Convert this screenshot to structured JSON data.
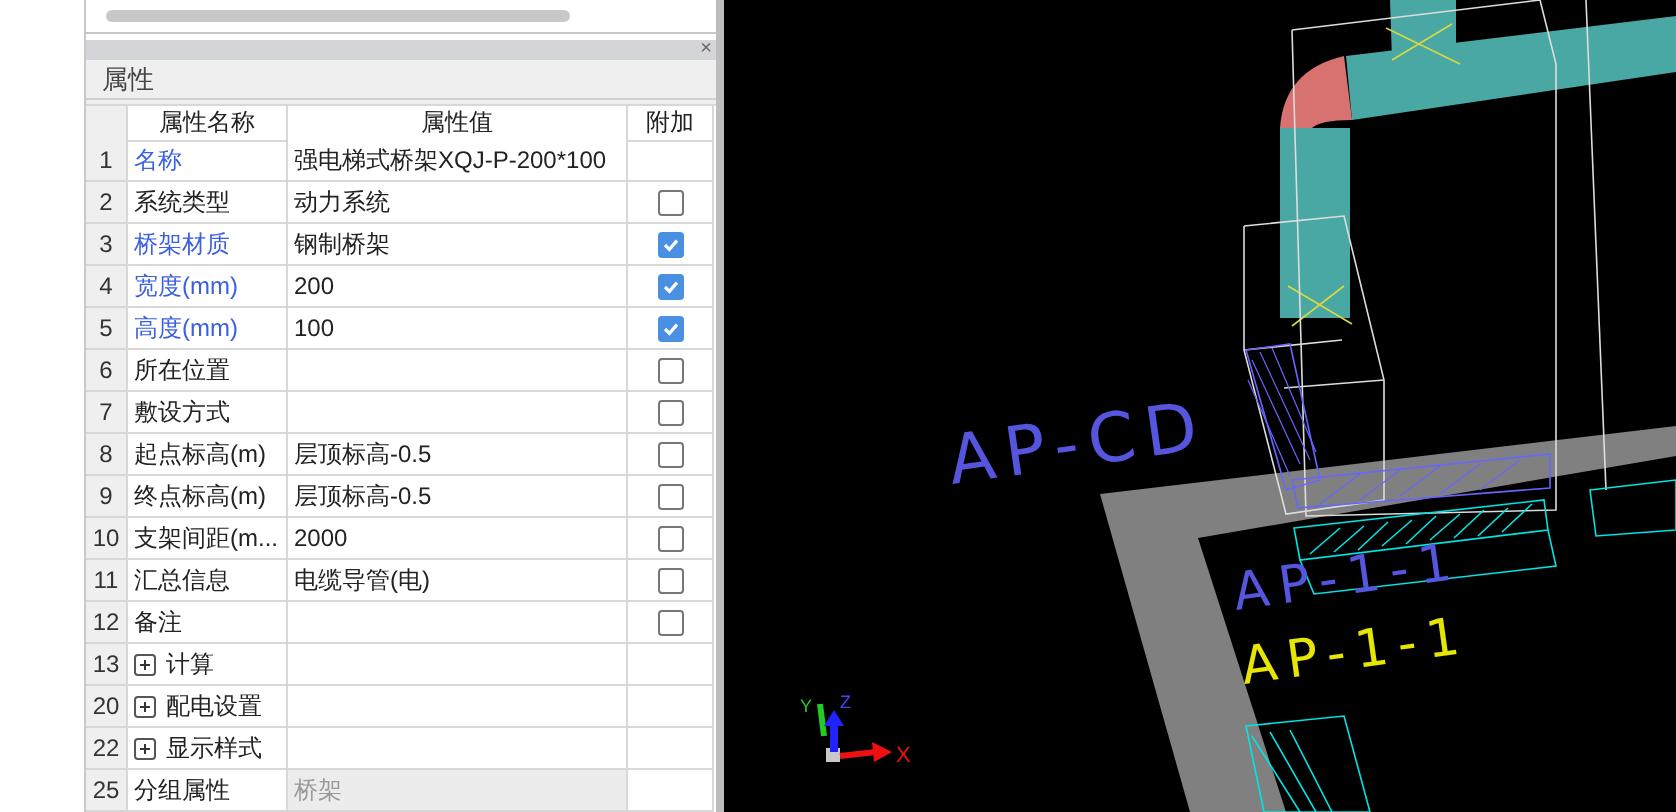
{
  "properties_panel": {
    "close": "×",
    "title": "属性",
    "columns": [
      "属性名称",
      "属性值",
      "附加"
    ],
    "rows": [
      {
        "index": "1",
        "kind": "text",
        "name": "名称",
        "value": "强电梯式桥架XQJ-P-200*100",
        "highlight": true,
        "disabled": false
      },
      {
        "index": "2",
        "kind": "checkbox",
        "name": "系统类型",
        "value": "动力系统",
        "highlight": false,
        "disabled": false,
        "checked": false
      },
      {
        "index": "3",
        "kind": "checkbox",
        "name": "桥架材质",
        "value": "钢制桥架",
        "highlight": true,
        "disabled": false,
        "checked": true
      },
      {
        "index": "4",
        "kind": "checkbox",
        "name": "宽度(mm)",
        "value": "200",
        "highlight": true,
        "disabled": false,
        "checked": true
      },
      {
        "index": "5",
        "kind": "checkbox",
        "name": "高度(mm)",
        "value": "100",
        "highlight": true,
        "disabled": false,
        "checked": true
      },
      {
        "index": "6",
        "kind": "checkbox",
        "name": "所在位置",
        "highlight": false,
        "disabled": false,
        "checked": false
      },
      {
        "index": "7",
        "kind": "checkbox",
        "name": "敷设方式",
        "highlight": false,
        "disabled": false,
        "checked": false
      },
      {
        "index": "8",
        "kind": "checkbox",
        "name": "起点标高(m)",
        "value": "层顶标高-0.5",
        "highlight": false,
        "disabled": false,
        "checked": false
      },
      {
        "index": "9",
        "kind": "checkbox",
        "name": "终点标高(m)",
        "value": "层顶标高-0.5",
        "highlight": false,
        "disabled": false,
        "checked": false
      },
      {
        "index": "10",
        "kind": "checkbox",
        "name": "支架间距(m...",
        "value": "2000",
        "highlight": false,
        "disabled": false,
        "checked": false
      },
      {
        "index": "11",
        "kind": "checkbox",
        "name": "汇总信息",
        "value": "电缆导管(电)",
        "highlight": false,
        "disabled": false,
        "checked": false
      },
      {
        "index": "12",
        "kind": "checkbox",
        "name": "备注",
        "highlight": false,
        "disabled": false,
        "checked": false
      },
      {
        "index": "13",
        "kind": "group",
        "name": "计算",
        "highlight": false,
        "disabled": false,
        "expanded": false
      },
      {
        "index": "20",
        "kind": "group",
        "name": "配电设置",
        "highlight": false,
        "disabled": false,
        "expanded": false
      },
      {
        "index": "22",
        "kind": "group",
        "name": "显示样式",
        "highlight": false,
        "disabled": false,
        "expanded": false
      },
      {
        "index": "25",
        "kind": "text",
        "name": "分组属性",
        "value": "桥架",
        "highlight": false,
        "disabled": true
      }
    ]
  },
  "viewport": {
    "labels": [
      {
        "text": "AP-CD",
        "color": "#5555dd"
      },
      {
        "text": "AP-1-1",
        "color": "#5555dd"
      },
      {
        "text": "AP-1-1",
        "color": "#e6e600"
      }
    ],
    "axes": [
      "X",
      "Y",
      "Z"
    ]
  }
}
